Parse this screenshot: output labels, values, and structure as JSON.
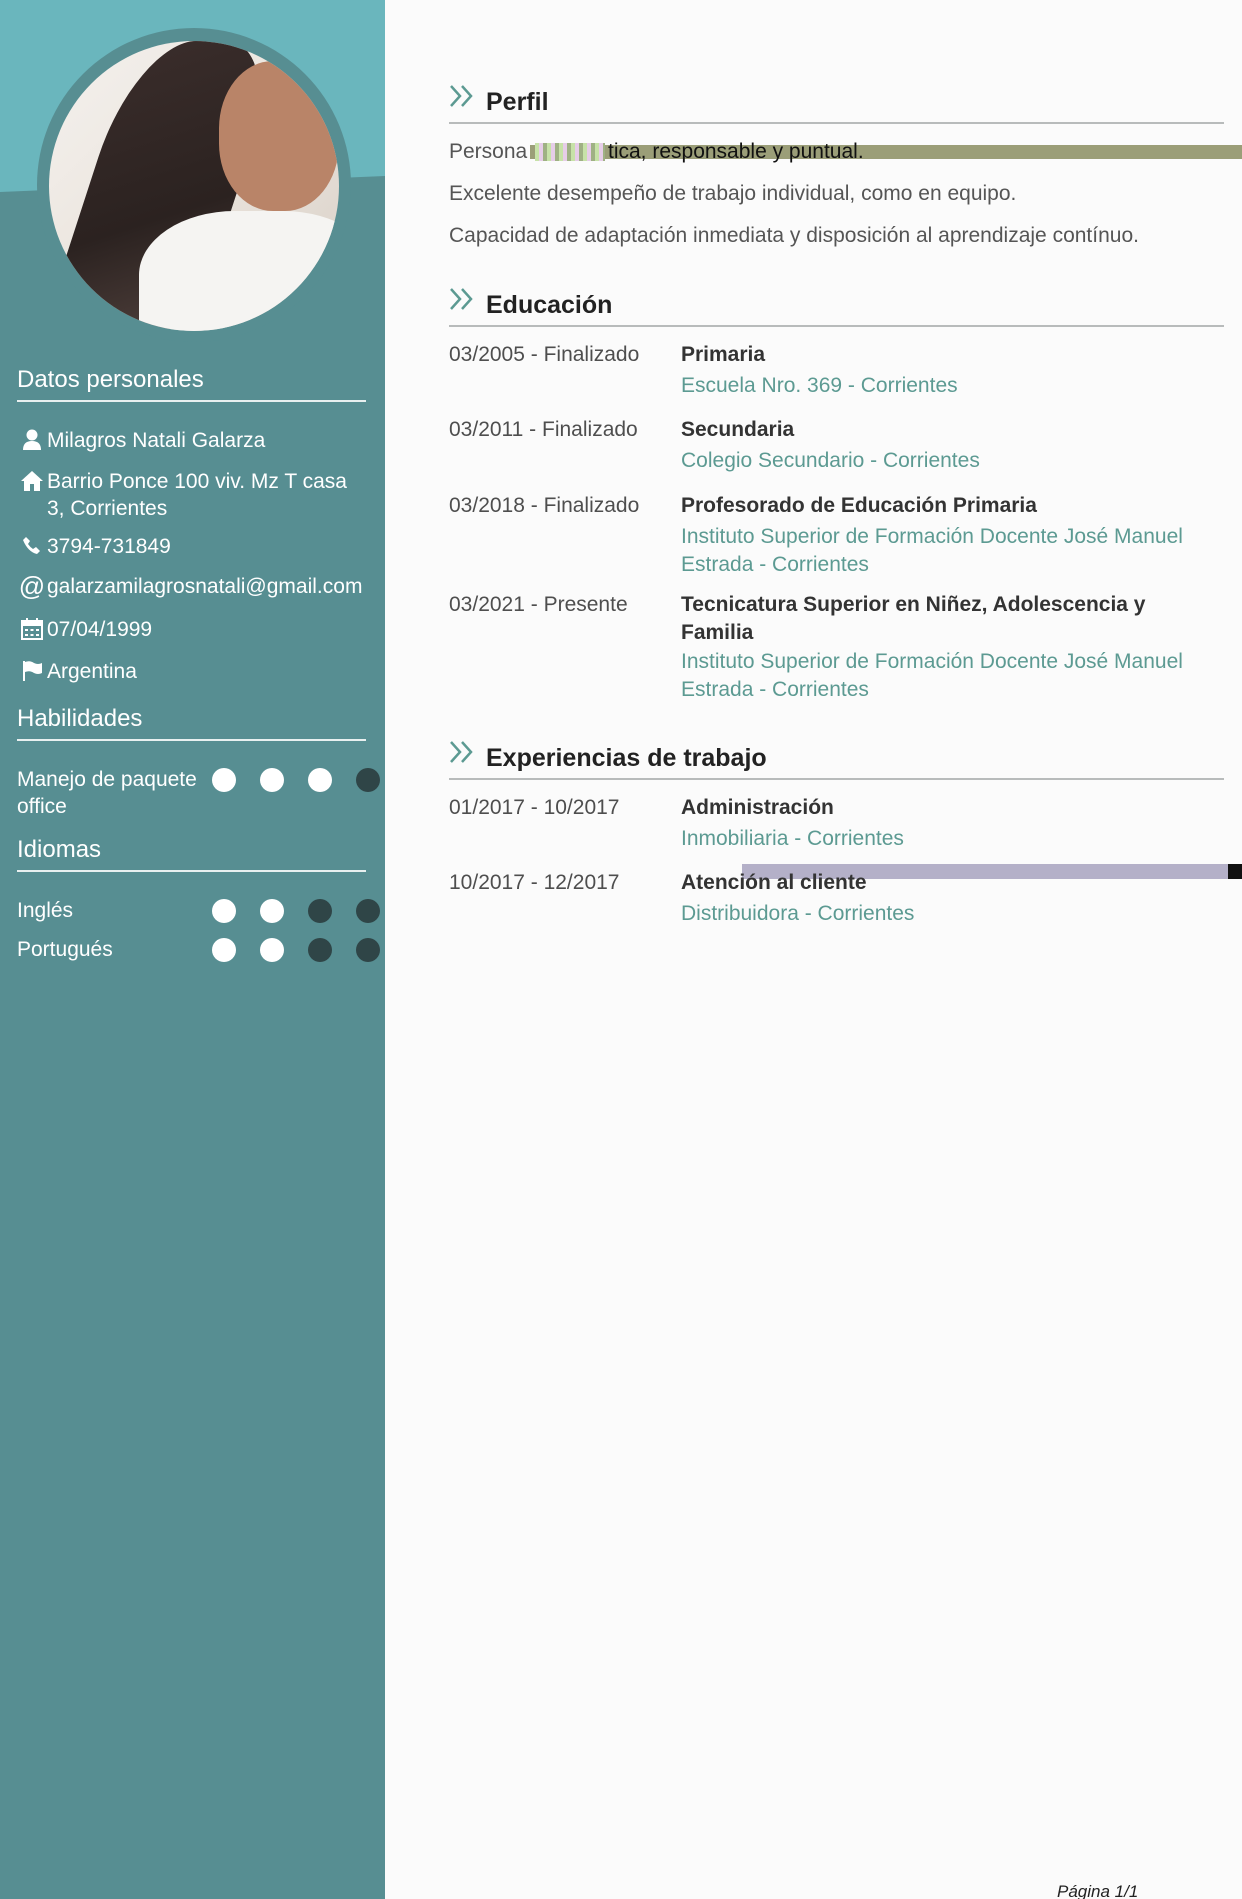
{
  "sidebar": {
    "personal_heading": "Datos personales",
    "personal": {
      "name": "Milagros Natali Galarza",
      "address": "Barrio Ponce 100 viv. Mz T casa 3, Corrientes",
      "phone": "3794-731849",
      "email": "galarzamilagrosnatali@gmail.com",
      "birthdate": "07/04/1999",
      "country": "Argentina"
    },
    "skills_heading": "Habilidades",
    "skills": [
      {
        "label": "Manejo de paquete office",
        "level": 3,
        "max": 4
      }
    ],
    "languages_heading": "Idiomas",
    "languages": [
      {
        "label": "Inglés",
        "level": 2,
        "max": 4
      },
      {
        "label": "Portugués",
        "level": 2,
        "max": 4
      }
    ]
  },
  "profile": {
    "heading": "Perfil",
    "lines": [
      "Persona",
      "tica, responsable y puntual.",
      "Excelente desempeño de trabajo individual, como en equipo.",
      "Capacidad de adaptación inmediata y disposición al aprendizaje contínuo."
    ]
  },
  "education": {
    "heading": "Educación",
    "entries": [
      {
        "date": "03/2005 - Finalizado",
        "title": "Primaria",
        "place": "Escuela Nro. 369 - Corrientes"
      },
      {
        "date": "03/2011 - Finalizado",
        "title": "Secundaria",
        "place": "Colegio Secundario - Corrientes"
      },
      {
        "date": "03/2018 - Finalizado",
        "title": "Profesorado de Educación Primaria",
        "place": "Instituto Superior de Formación Docente José Manuel Estrada - Corrientes"
      },
      {
        "date": "03/2021 - Presente",
        "title": "Tecnicatura Superior en Niñez, Adolescencia y Familia",
        "place": "Instituto Superior de Formación Docente José Manuel Estrada - Corrientes"
      }
    ]
  },
  "work": {
    "heading": "Experiencias de trabajo",
    "entries": [
      {
        "date": "01/2017 - 10/2017",
        "title": "Administración",
        "place": "Inmobiliaria - Corrientes"
      },
      {
        "date": "10/2017 - 12/2017",
        "title": "Atención al cliente",
        "place": "Distribuidora - Corrientes"
      }
    ]
  },
  "footer": {
    "page": "Página 1/1"
  },
  "colors": {
    "sidebar": "#578e92",
    "sidebar_top": "#6ab6bd",
    "accent_text": "#5c9a92",
    "dot_empty": "#2f4547",
    "dot_filled": "#ffffff"
  }
}
